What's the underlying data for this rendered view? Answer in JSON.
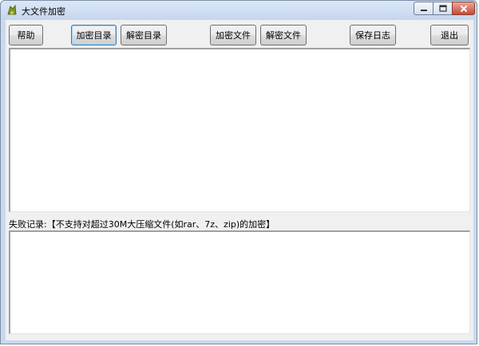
{
  "window": {
    "title": "大文件加密"
  },
  "toolbar": {
    "help": "帮助",
    "encrypt_dir": "加密目录",
    "decrypt_dir": "解密目录",
    "encrypt_file": "加密文件",
    "decrypt_file": "解密文件",
    "save_log": "保存日志",
    "exit": "退出"
  },
  "log": {
    "lines": []
  },
  "failures": {
    "label": "失败记录:【不支持对超过30M大压缩文件(如rar、7z、zip)的加密】",
    "lines": []
  },
  "icons": {
    "app": "app-icon",
    "minimize": "minimize-icon",
    "maximize": "maximize-icon",
    "close": "close-icon"
  }
}
